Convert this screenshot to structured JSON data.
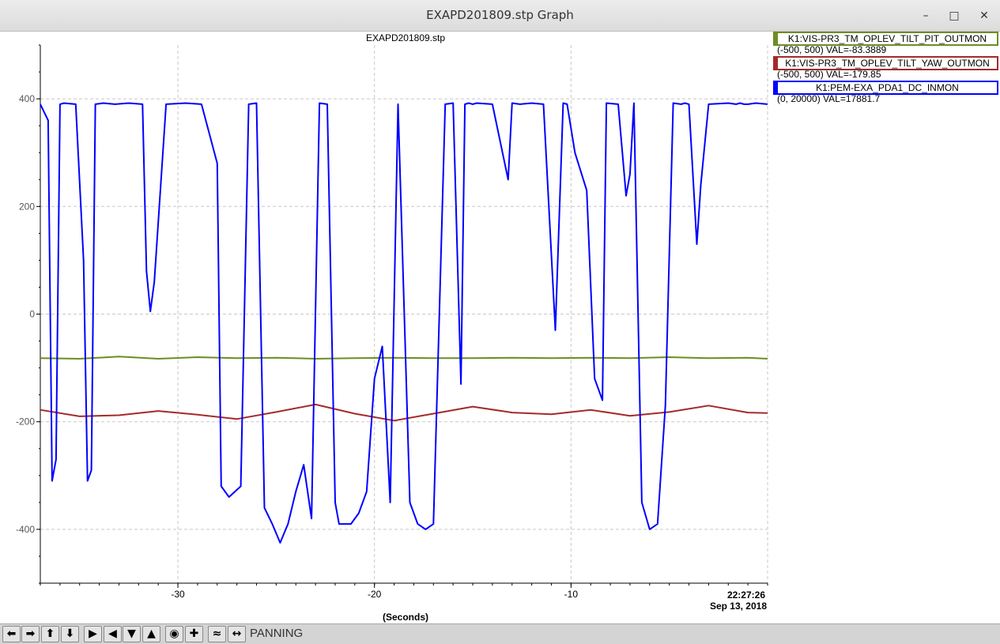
{
  "window": {
    "title": "EXAPD201809.stp Graph",
    "controls": [
      "minimize-icon",
      "maximize-icon",
      "close-icon"
    ]
  },
  "plot": {
    "title": "EXAPD201809.stp",
    "xlabel": "(Seconds)",
    "time_label": "22:27:26",
    "date_label": "Sep 13, 2018"
  },
  "legend": [
    {
      "name": "K1:VIS-PR3_TM_OPLEV_TILT_PIT_OUTMON",
      "range_value": "(-500, 500) VAL=-83.3889",
      "color": "#6b8e23"
    },
    {
      "name": "K1:VIS-PR3_TM_OPLEV_TILT_YAW_OUTMON",
      "range_value": "(-500, 500) VAL=-179.85",
      "color": "#a52a2a"
    },
    {
      "name": "K1:PEM-EXA_PDA1_DC_INMON",
      "range_value": "(0, 20000) VAL=17881.7",
      "color": "#0000ff"
    }
  ],
  "toolbar": {
    "buttons": [
      "pan-left-icon",
      "pan-right-icon",
      "pan-up-icon",
      "pan-down-icon",
      "zoom-x-in-icon",
      "zoom-x-out-icon",
      "zoom-y-in-icon",
      "zoom-y-out-icon",
      "reset-icon",
      "add-icon",
      "auto-scale-icon",
      "pan-mode-icon"
    ],
    "status": "PANNING"
  },
  "chart_data": {
    "type": "line",
    "title": "EXAPD201809.stp",
    "xlabel": "(Seconds)",
    "ylabel": "",
    "xlim": [
      -37,
      0
    ],
    "ylim": [
      -500,
      500
    ],
    "x_ticks": [
      -30,
      -20,
      -10
    ],
    "y_ticks": [
      400,
      200,
      0,
      -200,
      -400
    ],
    "grid": true,
    "legend_placement": "right",
    "series": [
      {
        "name": "K1:VIS-PR3_TM_OPLEV_TILT_PIT_OUTMON",
        "color": "#6b8e23",
        "x": [
          -37,
          -35,
          -33,
          -31,
          -29,
          -27,
          -25,
          -23,
          -21,
          -19,
          -17,
          -15,
          -13,
          -11,
          -9,
          -7,
          -5,
          -3,
          -1,
          0
        ],
        "y": [
          -82,
          -83,
          -79,
          -83,
          -80,
          -82,
          -81,
          -83,
          -82,
          -81,
          -82,
          -82,
          -81,
          -82,
          -81,
          -82,
          -80,
          -82,
          -81,
          -83
        ]
      },
      {
        "name": "K1:VIS-PR3_TM_OPLEV_TILT_YAW_OUTMON",
        "color": "#a52a2a",
        "x": [
          -37,
          -35,
          -33,
          -31,
          -29,
          -27,
          -25,
          -23,
          -21,
          -19,
          -17,
          -15,
          -13,
          -11,
          -9,
          -7,
          -5,
          -3,
          -1,
          0
        ],
        "y": [
          -178,
          -190,
          -188,
          -180,
          -187,
          -195,
          -182,
          -168,
          -185,
          -198,
          -185,
          -172,
          -183,
          -186,
          -178,
          -189,
          -182,
          -170,
          -183,
          -184
        ]
      },
      {
        "name": "K1:PEM-EXA_PDA1_DC_INMON",
        "color": "#0000ff",
        "x": [
          -37,
          -36.6,
          -36.4,
          -36.2,
          -36,
          -35.8,
          -35.2,
          -34.8,
          -34.6,
          -34.4,
          -34.2,
          -33.8,
          -33.2,
          -32.5,
          -31.8,
          -31.6,
          -31.4,
          -31.2,
          -30.6,
          -29.6,
          -28.8,
          -28,
          -27.8,
          -27.4,
          -26.8,
          -26.4,
          -26,
          -25.6,
          -25.2,
          -24.8,
          -24.4,
          -24,
          -23.6,
          -23.2,
          -22.8,
          -22.4,
          -22,
          -21.8,
          -21.6,
          -21.2,
          -20.8,
          -20.4,
          -20,
          -19.6,
          -19.2,
          -18.8,
          -18.2,
          -17.8,
          -17.4,
          -17,
          -16.4,
          -16,
          -15.6,
          -15.4,
          -15.2,
          -15,
          -14.8,
          -14,
          -13.2,
          -13,
          -12.6,
          -12,
          -11.4,
          -10.8,
          -10.4,
          -10.2,
          -9.8,
          -9.2,
          -8.8,
          -8.4,
          -8.2,
          -7.6,
          -7.2,
          -7,
          -6.8,
          -6.4,
          -6,
          -5.6,
          -5.2,
          -4.8,
          -4.4,
          -4.2,
          -4,
          -3.6,
          -3.4,
          -3,
          -2,
          -1.6,
          -1.4,
          -1.2,
          -1,
          -0.6,
          0
        ],
        "y": [
          390,
          360,
          -310,
          -270,
          390,
          392,
          390,
          100,
          -310,
          -290,
          390,
          392,
          390,
          392,
          390,
          80,
          5,
          60,
          390,
          392,
          390,
          280,
          -320,
          -340,
          -320,
          390,
          392,
          -360,
          -390,
          -425,
          -390,
          -330,
          -280,
          -380,
          392,
          390,
          -350,
          -390,
          -390,
          -390,
          -370,
          -330,
          -120,
          -60,
          -350,
          390,
          -350,
          -390,
          -400,
          -390,
          390,
          392,
          -130,
          390,
          392,
          390,
          392,
          390,
          250,
          392,
          390,
          392,
          390,
          -30,
          392,
          390,
          300,
          230,
          -120,
          -160,
          392,
          390,
          220,
          260,
          392,
          -350,
          -400,
          -390,
          -170,
          392,
          390,
          392,
          390,
          130,
          240,
          390,
          392,
          390,
          392,
          390,
          390,
          392,
          390
        ]
      }
    ]
  }
}
